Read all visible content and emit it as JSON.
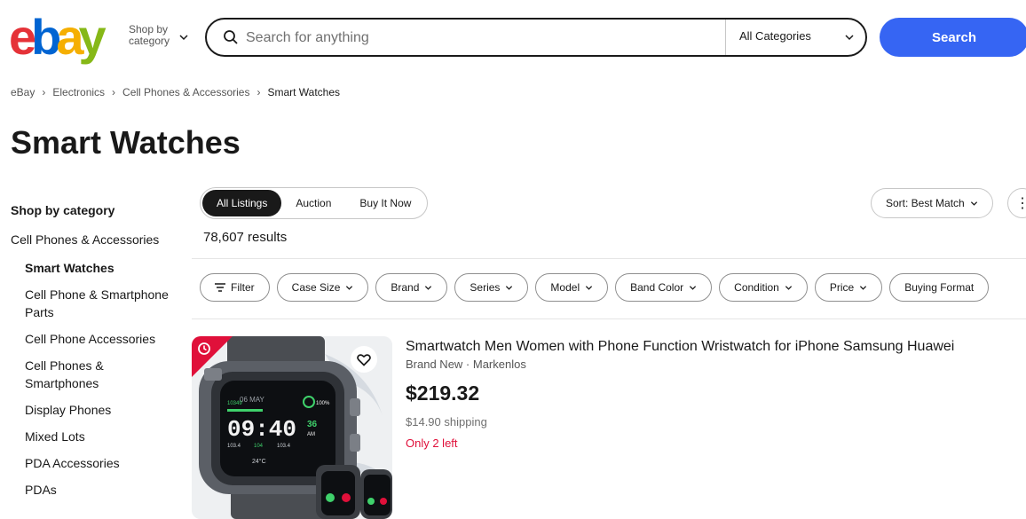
{
  "header": {
    "logo_letters": [
      "e",
      "b",
      "a",
      "y"
    ],
    "logo_colors": [
      "#e53238",
      "#0064d2",
      "#f5af02",
      "#86b817"
    ],
    "shop_by_line1": "Shop by",
    "shop_by_line2": "category",
    "search_placeholder": "Search for anything",
    "category_select": "All Categories",
    "search_button": "Search"
  },
  "breadcrumb": [
    "eBay",
    "Electronics",
    "Cell Phones & Accessories",
    "Smart Watches"
  ],
  "page_title": "Smart Watches",
  "sidebar": {
    "heading": "Shop by category",
    "parent": "Cell Phones & Accessories",
    "items": [
      {
        "label": "Smart Watches",
        "active": true
      },
      {
        "label": "Cell Phone & Smartphone Parts",
        "active": false
      },
      {
        "label": "Cell Phone Accessories",
        "active": false
      },
      {
        "label": "Cell Phones & Smartphones",
        "active": false
      },
      {
        "label": "Display Phones",
        "active": false
      },
      {
        "label": "Mixed Lots",
        "active": false
      },
      {
        "label": "PDA Accessories",
        "active": false
      },
      {
        "label": "PDAs",
        "active": false
      }
    ]
  },
  "listing_tabs": [
    "All Listings",
    "Auction",
    "Buy It Now"
  ],
  "results_count": "78,607 results",
  "sort_label": "Sort: Best Match",
  "filters": {
    "filter_label": "Filter",
    "pills": [
      "Case Size",
      "Brand",
      "Series",
      "Model",
      "Band Color",
      "Condition",
      "Price",
      "Buying Format"
    ]
  },
  "item": {
    "title": "Smartwatch Men Women with Phone Function Wristwatch for iPhone Samsung Huawei",
    "subtitle": "Brand New · Markenlos",
    "price": "$219.32",
    "shipping": "$14.90 shipping",
    "stock": "Only 2 left",
    "watch_date": "06 MAY",
    "watch_time": "09:40",
    "watch_seconds": "36",
    "watch_ampm": "AM",
    "watch_battery": "100%",
    "watch_temp": "24°C",
    "watch_steps": "10349",
    "watch_stat_1": "103.4",
    "watch_stat_2": "104",
    "watch_stat_3": "103.4",
    "deal_color": "#e0103a"
  }
}
